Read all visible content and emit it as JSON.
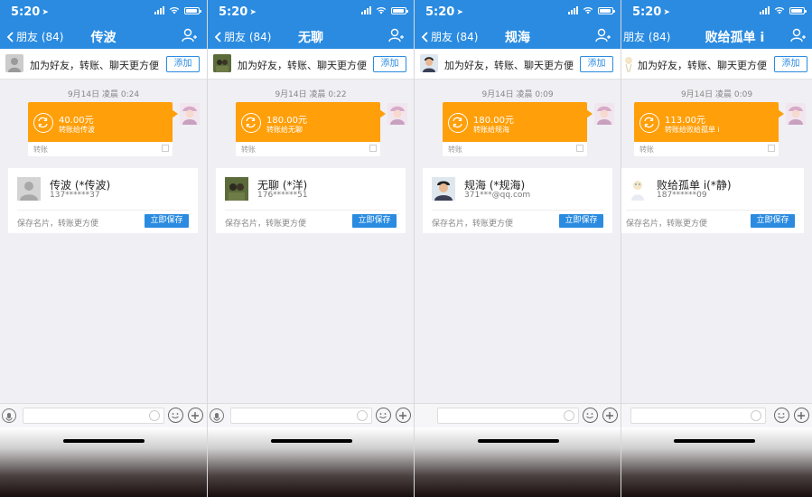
{
  "status_bar": {
    "time": "5:20",
    "battery_level": 0.85
  },
  "common": {
    "back_label": "朋友 (84)",
    "add_friend_text": "加为好友，转账、聊天更方便",
    "add_button": "添加",
    "transfer_label": "转账",
    "save_hint": "保存名片，转账更方便",
    "save_button": "立即保存"
  },
  "colors": {
    "header_blue": "#2a8be0",
    "transfer_orange": "#ff9f0a"
  },
  "panels": [
    {
      "title": "传波",
      "timestamp": "9月14日 凌晨 0:24",
      "amount": "40.00元",
      "transfer_to": "转账给传波",
      "card_name": "传波 (*传波)",
      "card_sub": "137******37",
      "avatar": "default-avatar-icon"
    },
    {
      "title": "无聊",
      "timestamp": "9月14日 凌晨 0:22",
      "amount": "180.00元",
      "transfer_to": "转账给无聊",
      "card_name": "无聊 (*洋)",
      "card_sub": "176******51",
      "avatar": "photo-avatar-icon"
    },
    {
      "title": "规海",
      "timestamp": "9月14日 凌晨 0:09",
      "amount": "180.00元",
      "transfer_to": "转账给规海",
      "card_name": "规海 (*规海)",
      "card_sub": "371***@qq.com",
      "avatar": "person-photo-avatar-icon"
    },
    {
      "title": "败给孤单 i",
      "timestamp": "9月14日 凌晨 0:09",
      "amount": "113.00元",
      "transfer_to": "转账给败给孤单 i",
      "card_name": "败给孤单 i(*静)",
      "card_sub": "187******09",
      "avatar": "illustration-avatar-icon"
    }
  ]
}
